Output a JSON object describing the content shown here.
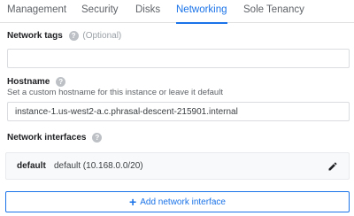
{
  "tabs": [
    {
      "label": "Management",
      "active": false
    },
    {
      "label": "Security",
      "active": false
    },
    {
      "label": "Disks",
      "active": false
    },
    {
      "label": "Networking",
      "active": true
    },
    {
      "label": "Sole Tenancy",
      "active": false
    }
  ],
  "network_tags": {
    "label": "Network tags",
    "optional": "(Optional)",
    "value": "",
    "help_icon": "help-circle-icon"
  },
  "hostname": {
    "label": "Hostname",
    "help_text": "Set a custom hostname for this instance or leave it default",
    "value": "instance-1.us-west2-a.c.phrasal-descent-215901.internal",
    "help_icon": "help-circle-icon"
  },
  "network_interfaces": {
    "label": "Network interfaces",
    "help_icon": "help-circle-icon",
    "items": [
      {
        "name": "default",
        "detail": "default (10.168.0.0/20)",
        "edit_icon": "pencil-icon"
      }
    ],
    "add_label": "Add network interface",
    "add_icon": "plus-icon"
  },
  "colors": {
    "accent": "#1a73e8",
    "text": "#202124",
    "muted": "#5f6368"
  }
}
